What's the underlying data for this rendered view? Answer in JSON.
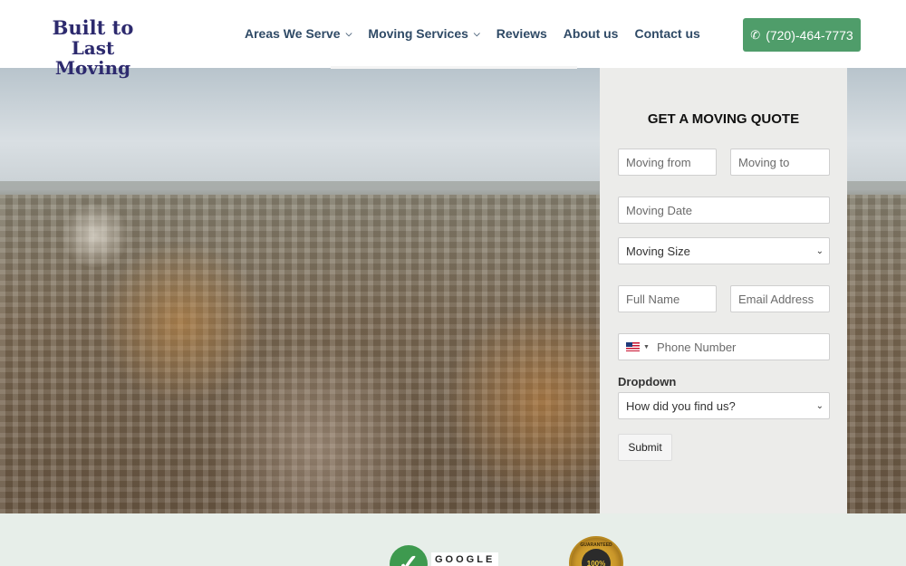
{
  "brand": {
    "line1": "Built to",
    "line2": "Last Moving"
  },
  "nav": {
    "items": [
      {
        "label": "Areas We Serve",
        "has_dropdown": true
      },
      {
        "label": "Moving Services",
        "has_dropdown": true
      },
      {
        "label": "Reviews",
        "has_dropdown": false
      },
      {
        "label": "About us",
        "has_dropdown": false
      },
      {
        "label": "Contact us",
        "has_dropdown": false
      }
    ]
  },
  "phone": {
    "label": "(720)-464-7773",
    "icon": "phone-icon"
  },
  "quote_form": {
    "title": "GET A MOVING QUOTE",
    "moving_from_placeholder": "Moving from",
    "moving_to_placeholder": "Moving to",
    "moving_date_placeholder": "Moving Date",
    "moving_size_selected": "Moving Size",
    "full_name_placeholder": "Full Name",
    "email_placeholder": "Email Address",
    "phone_placeholder": "Phone Number",
    "phone_country_flag": "us-flag-icon",
    "dropdown_label": "Dropdown",
    "dropdown_selected": "How did you find us?",
    "submit_label": "Submit"
  },
  "badges": {
    "google_text": "GOOGLE",
    "seal_top": "GUARANTEED",
    "seal_text": "100%"
  },
  "colors": {
    "accent_green": "#4f9d6a",
    "nav_text": "#2f4a66",
    "logo": "#2d2a6e",
    "form_bg": "#ececea",
    "bottom_band": "#e7eee9"
  }
}
